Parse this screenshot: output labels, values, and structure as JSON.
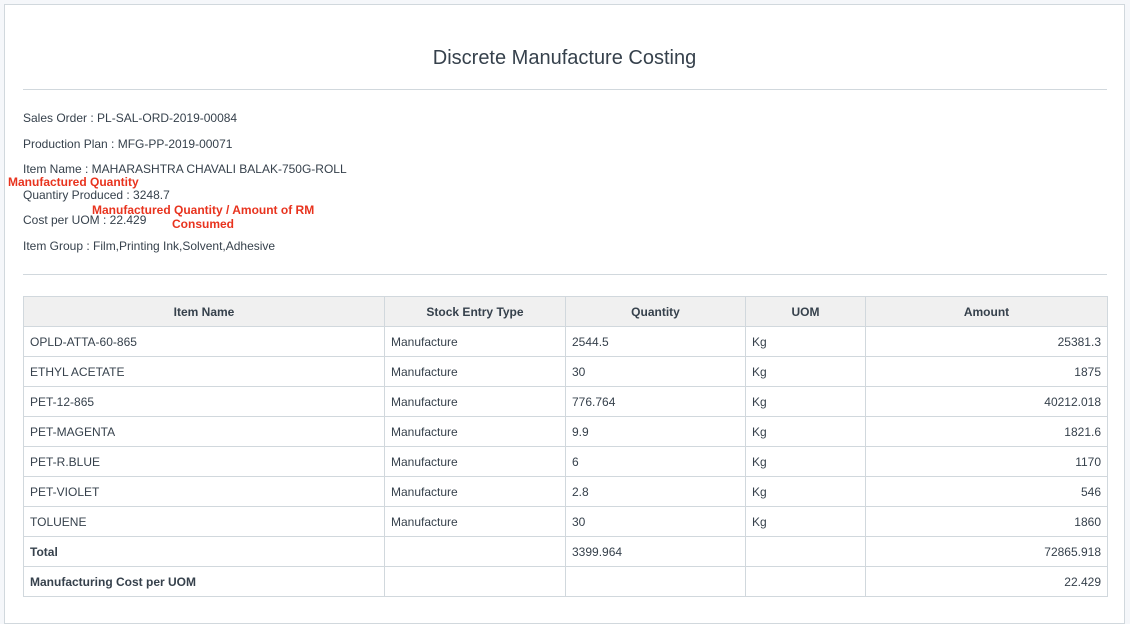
{
  "report": {
    "title": "Discrete Manufacture Costing",
    "sales_order": "Sales Order : PL-SAL-ORD-2019-00084",
    "production_plan": "Production Plan : MFG-PP-2019-00071",
    "item_name": "Item Name : MAHARASHTRA CHAVALI BALAK-750G-ROLL",
    "quantity_produced": "Quantiry Produced : 3248.7",
    "cost_per_uom": "Cost per UOM : 22.429",
    "item_group": "Item Group : Film,Printing Ink,Solvent,Adhesive"
  },
  "annotations": {
    "manufactured_quantity": "Manufactured Quantity",
    "cost_formula_line1": "Manufactured Quantity / Amount of RM",
    "cost_formula_line2": "Consumed",
    "color": "#e8331e"
  },
  "table": {
    "headers": [
      "Item Name",
      "Stock Entry Type",
      "Quantity",
      "UOM",
      "Amount"
    ],
    "rows": [
      [
        "OPLD-ATTA-60-865",
        "Manufacture",
        "2544.5",
        "Kg",
        "25381.3"
      ],
      [
        "ETHYL ACETATE",
        "Manufacture",
        "30",
        "Kg",
        "1875"
      ],
      [
        "PET-12-865",
        "Manufacture",
        "776.764",
        "Kg",
        "40212.018"
      ],
      [
        "PET-MAGENTA",
        "Manufacture",
        "9.9",
        "Kg",
        "1821.6"
      ],
      [
        "PET-R.BLUE",
        "Manufacture",
        "6",
        "Kg",
        "1170"
      ],
      [
        "PET-VIOLET",
        "Manufacture",
        "2.8",
        "Kg",
        "546"
      ],
      [
        "TOLUENE",
        "Manufacture",
        "30",
        "Kg",
        "1860"
      ]
    ],
    "total": [
      "Total",
      "",
      "3399.964",
      "",
      "72865.918"
    ],
    "cost_per_uom_row": [
      "Manufacturing Cost per UOM",
      "",
      "",
      "",
      "22.429"
    ]
  }
}
